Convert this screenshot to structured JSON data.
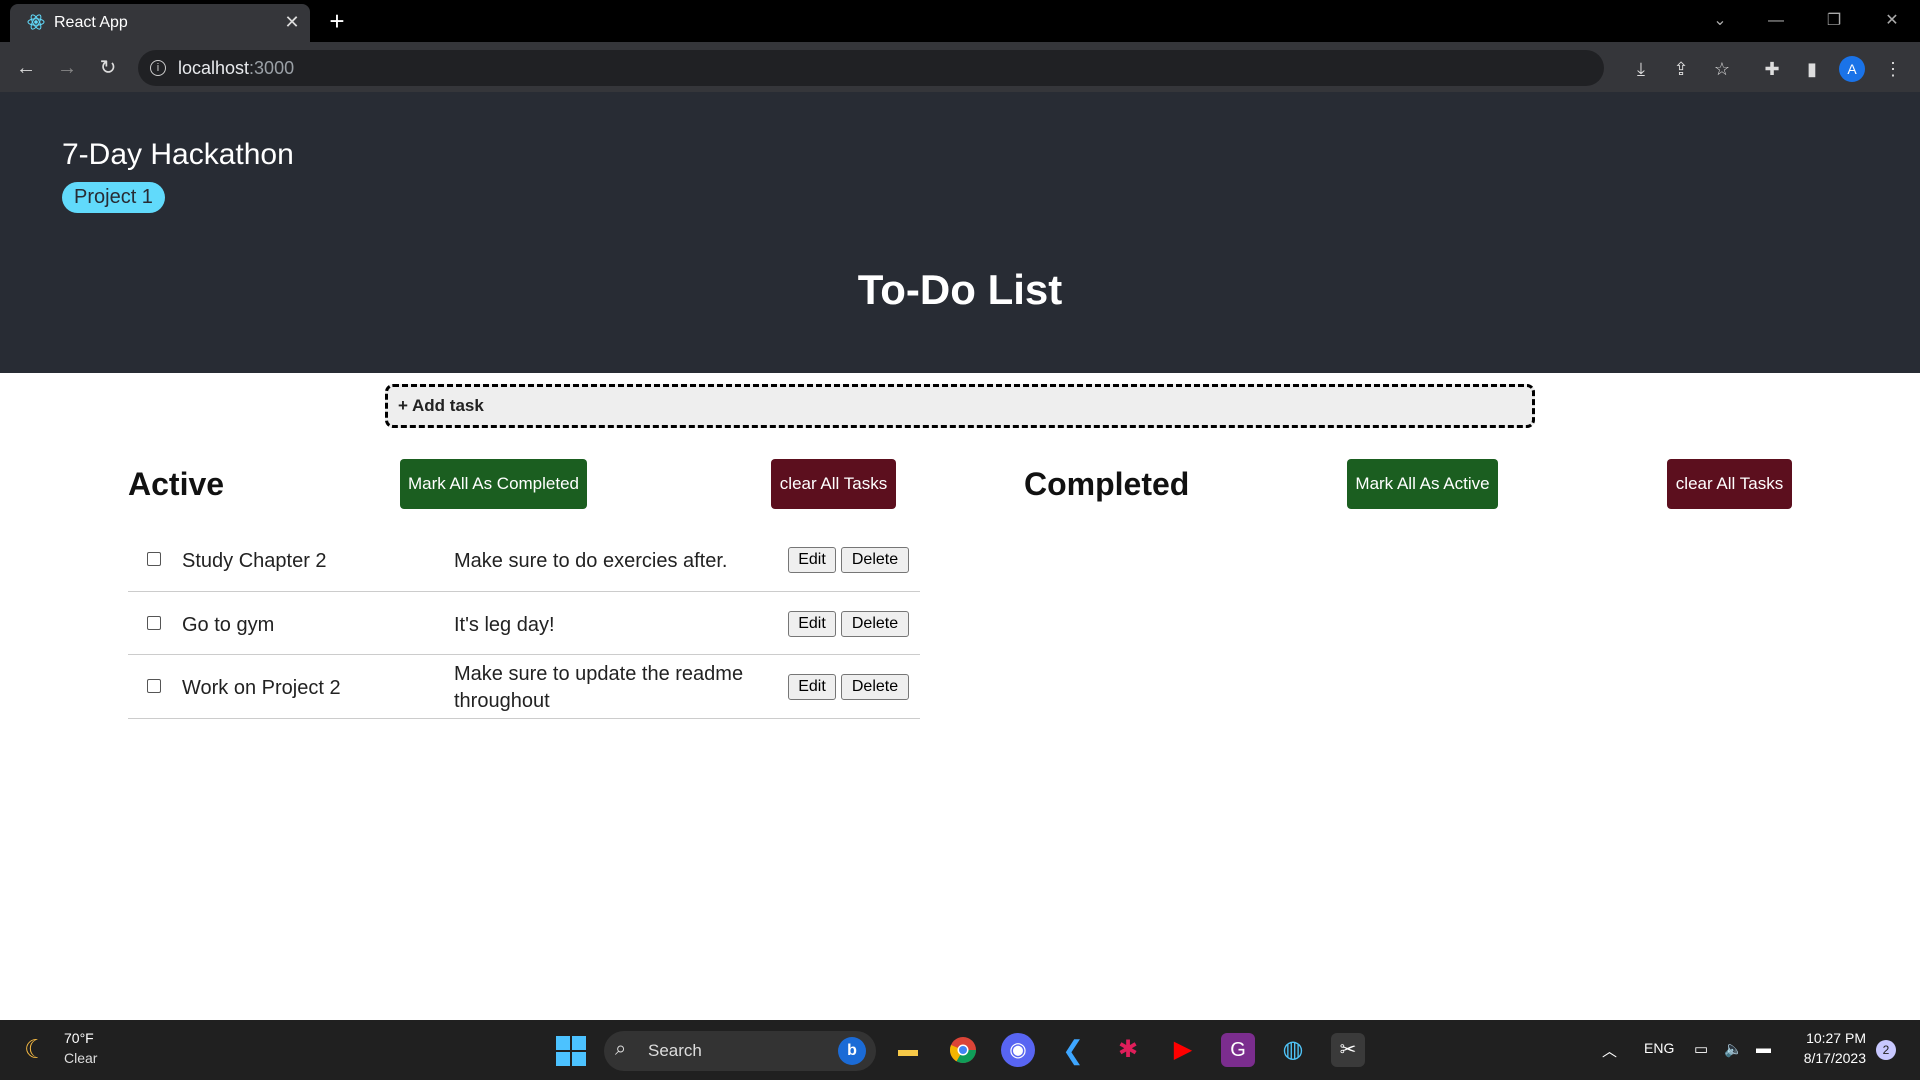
{
  "browser": {
    "tab_title": "React App",
    "url_host": "localhost",
    "url_port": ":3000",
    "avatar_letter": "A"
  },
  "header": {
    "hackathon_title": "7-Day Hackathon",
    "project_badge": "Project 1",
    "page_title": "To-Do List"
  },
  "add_task": {
    "label": "+ Add task"
  },
  "active": {
    "title": "Active",
    "mark_all_label": "Mark All As Completed",
    "clear_label": "clear All Tasks",
    "tasks": [
      {
        "name": "Study Chapter 2",
        "description": "Make sure to do exercies after.",
        "completed": false
      },
      {
        "name": "Go to gym",
        "description": "It's leg day!",
        "completed": false
      },
      {
        "name": "Work on Project 2",
        "description": "Make sure to update the readme throughout",
        "completed": false
      }
    ],
    "edit_label": "Edit",
    "delete_label": "Delete"
  },
  "completed": {
    "title": "Completed",
    "mark_all_label": "Mark All As Active",
    "clear_label": "clear All Tasks",
    "tasks": []
  },
  "taskbar": {
    "weather_temp": "70°F",
    "weather_condition": "Clear",
    "search_label": "Search",
    "language": "ENG",
    "time": "10:27 PM",
    "date": "8/17/2023",
    "notification_count": "2"
  },
  "colors": {
    "header_bg": "#282c34",
    "badge_bg": "#61dafb",
    "green_button": "#1b5e20",
    "red_button": "#5c0f1e"
  }
}
